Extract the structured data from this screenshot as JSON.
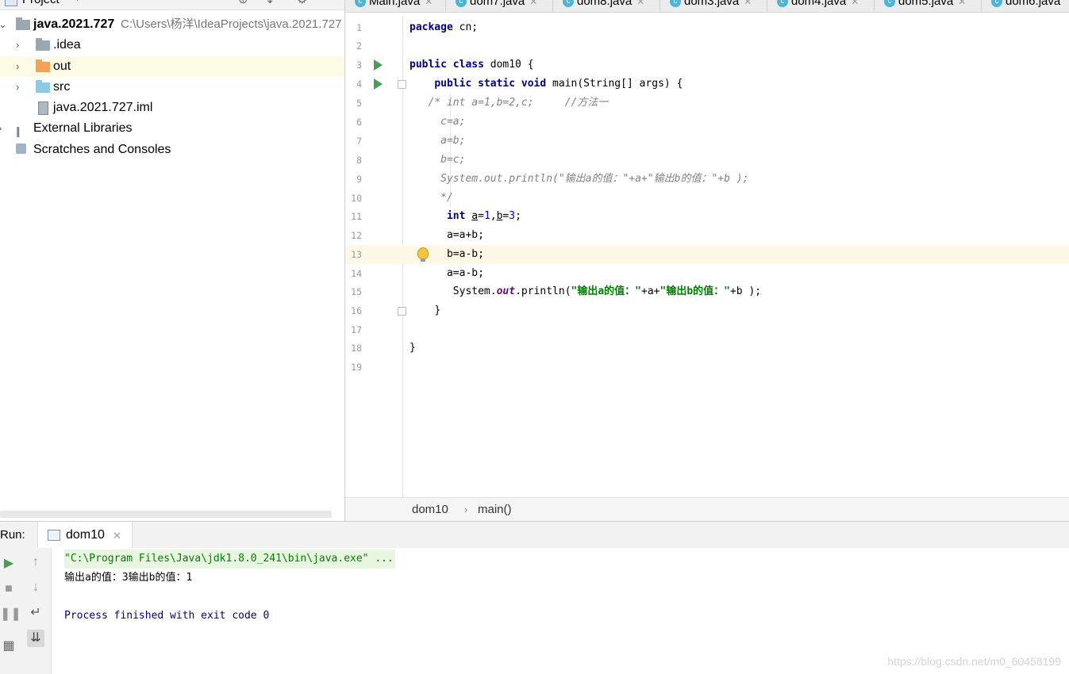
{
  "project": {
    "title": "Project",
    "root": {
      "name": "java.2021.727",
      "path": "C:\\Users\\杨洋\\IdeaProjects\\java.2021.727"
    },
    "items": [
      {
        "label": ".idea"
      },
      {
        "label": "out"
      },
      {
        "label": "src"
      },
      {
        "label": "java.2021.727.iml"
      },
      {
        "label": "External Libraries"
      },
      {
        "label": "Scratches and Consoles"
      }
    ]
  },
  "tabs": [
    "Main.java",
    "dom7.java",
    "dom8.java",
    "dom3.java",
    "dom4.java",
    "dom5.java",
    "dom6.java"
  ],
  "code_lines": [
    "1",
    "2",
    "3",
    "4",
    "5",
    "6",
    "7",
    "8",
    "9",
    "10",
    "11",
    "12",
    "13",
    "14",
    "15",
    "16",
    "17",
    "18",
    "19"
  ],
  "code": {
    "l1_kw": "package",
    "l1_rest": " cn;",
    "l3_kw": "public class",
    "l3_rest": " dom10 {",
    "l4_kw": "public static void",
    "l4_rest": " main(String[] args) {",
    "l5": "/* int a=1,b=2,c;     //方法一",
    "l6": "c=a;",
    "l7": "a=b;",
    "l8": "b=c;",
    "l9": "System.out.println(\"输出a的值：\"+a+\"输出b的值：\"+b );",
    "l10": "*/",
    "l11_kw": "int",
    "l11_a": "a",
    "l11_eq1": "=",
    "l11_n1": "1",
    "l11_comma": ",",
    "l11_b": "b",
    "l11_eq2": "=",
    "l11_n2": "3",
    "l11_end": ";",
    "l12": "a=a+b;",
    "l13": "b=a-b;",
    "l14": "a=a-b;",
    "l15_a": "System.",
    "l15_out": "out",
    "l15_b": ".println(",
    "l15_s1": "\"输出a的值：\"",
    "l15_c": "+a+",
    "l15_s2": "\"输出b的值：\"",
    "l15_d": "+b );",
    "l16": "}",
    "l18": "}"
  },
  "breadcrumb": {
    "class": "dom10",
    "method": "main()"
  },
  "run": {
    "label": "Run:",
    "tab": "dom10",
    "console": [
      "\"C:\\Program Files\\Java\\jdk1.8.0_241\\bin\\java.exe\" ...",
      "输出a的值：3输出b的值：1",
      "Process finished with exit code 0"
    ]
  },
  "watermark": "https://blog.csdn.net/m0_60458199"
}
